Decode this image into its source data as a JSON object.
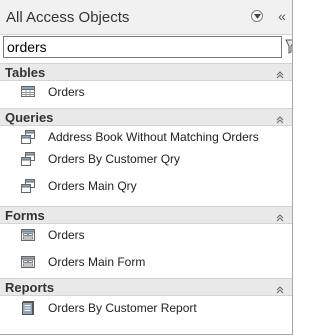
{
  "pane": {
    "title": "All Access Objects",
    "dropdown_icon": "dropdown-circle-icon",
    "shutter_icon": "double-chevron-left-icon"
  },
  "search": {
    "value": "orders",
    "icon": "clear-search-icon"
  },
  "groups": [
    {
      "label": "Tables",
      "chevron_icon": "double-chevron-up-icon",
      "items": [
        {
          "label": "Orders",
          "icon": "table-icon"
        }
      ]
    },
    {
      "label": "Queries",
      "chevron_icon": "double-chevron-up-icon",
      "items": [
        {
          "label": "Address Book Without Matching Orders",
          "icon": "query-icon"
        },
        {
          "label": "Orders By Customer Qry",
          "icon": "query-icon"
        },
        {
          "label": "Orders Main Qry",
          "icon": "query-icon"
        }
      ]
    },
    {
      "label": "Forms",
      "chevron_icon": "double-chevron-up-icon",
      "items": [
        {
          "label": "Orders",
          "icon": "form-icon"
        },
        {
          "label": "Orders Main Form",
          "icon": "form-icon"
        }
      ]
    },
    {
      "label": "Reports",
      "chevron_icon": "double-chevron-up-icon",
      "items": [
        {
          "label": "Orders By Customer Report",
          "icon": "report-icon"
        }
      ]
    }
  ]
}
